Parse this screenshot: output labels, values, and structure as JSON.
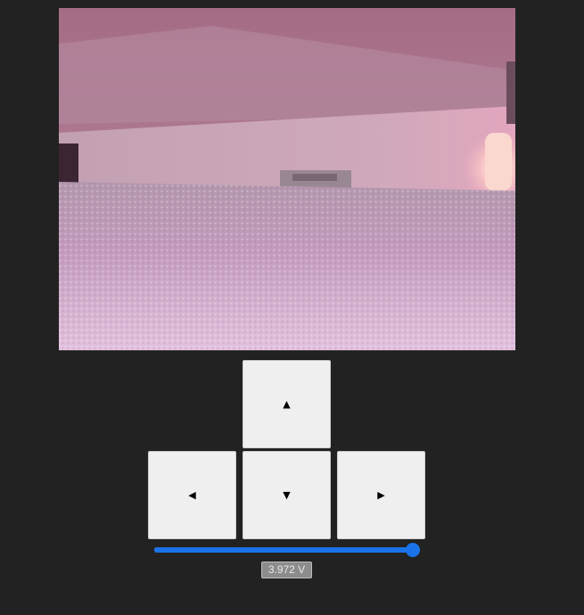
{
  "camera": {
    "description_icon": "camera-feed"
  },
  "controls": {
    "up": {
      "icon": "arrow-up-icon",
      "glyph": "▲"
    },
    "left": {
      "icon": "arrow-left-icon",
      "glyph": "◀"
    },
    "down": {
      "icon": "arrow-down-icon",
      "glyph": "▼"
    },
    "right": {
      "icon": "arrow-right-icon",
      "glyph": "▶"
    }
  },
  "slider": {
    "value_fraction": 1.0,
    "accent_color": "#1a73e8"
  },
  "status": {
    "voltage_label": "3.972 V"
  }
}
